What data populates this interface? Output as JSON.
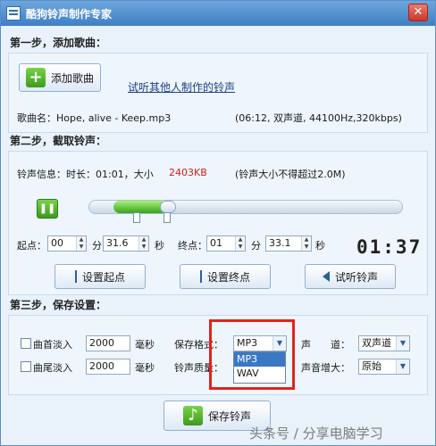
{
  "window": {
    "title": "酷狗铃声制作专家",
    "close": "✕"
  },
  "step1": {
    "heading": "第一步，添加歌曲：",
    "add_song_label": "添加歌曲",
    "add_song_icon": "+",
    "link": "试听其他人制作的铃声",
    "song_name": "歌曲名：Hope, alive - Keep.mp3",
    "song_info": "(06:12, 双声道, 44100Hz,320kbps)"
  },
  "step2": {
    "heading": "第二步，截取铃声：",
    "info_prefix": "铃声信息：时长：01:01，大小",
    "info_size": "2403KB",
    "info_note": "(铃声大小不得超过2.0M)",
    "progress": {
      "start": 0.08,
      "end": 0.25
    },
    "start_label": "起点：",
    "start_min": "00",
    "start_sec": "31.6",
    "end_label": "终点：",
    "end_min": "01",
    "end_sec": "33.1",
    "min_unit": "分",
    "sec_unit": "秒",
    "lcd": "01:37",
    "set_start": "设置起点",
    "set_end": "设置终点",
    "preview": "试听铃声"
  },
  "step3": {
    "heading": "第三步，保存设置：",
    "fade_in_label": "曲首淡入",
    "fade_in_value": "2000",
    "fade_out_label": "曲尾淡入",
    "fade_out_value": "2000",
    "ms_unit": "毫秒",
    "format_label": "保存格式：",
    "format_value": "MP3",
    "format_options": [
      "MP3",
      "WAV"
    ],
    "quality_label": "铃声质量：",
    "channel_label": "声　　道：",
    "channel_value": "双声道",
    "volume_label": "声音增大：",
    "volume_value": "原始",
    "save_label": "保存铃声",
    "save_icon": "♪"
  },
  "watermark": "头条号 / 分享电脑学习",
  "colors": {
    "accent": "#3a78c6",
    "highlight": "#e3231c",
    "green": "#3f9a1c"
  }
}
